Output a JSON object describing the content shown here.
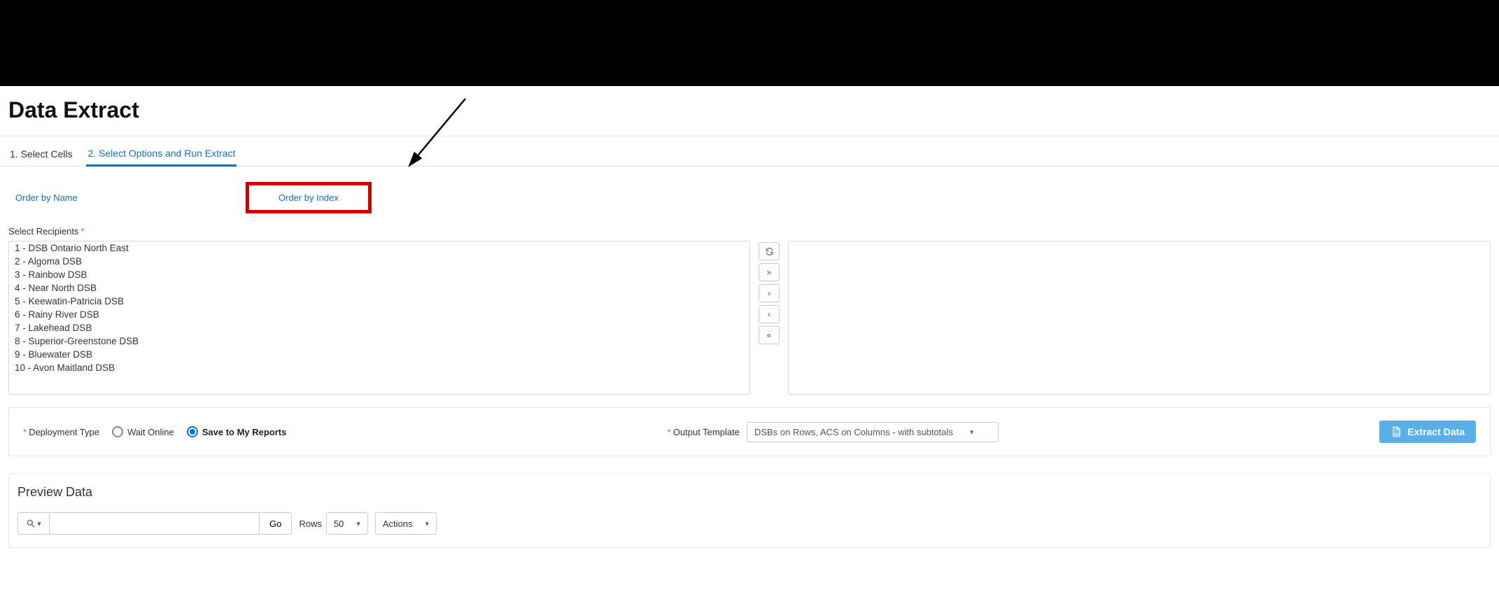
{
  "page": {
    "title": "Data Extract"
  },
  "tabs": {
    "t1": "1. Select Cells",
    "t2": "2. Select Options and Run Extract"
  },
  "order": {
    "by_name": "Order by Name",
    "by_index": "Order by Index"
  },
  "recipients": {
    "label": "Select Recipients",
    "items": [
      "1 - DSB Ontario North East",
      "2 - Algoma DSB",
      "3 - Rainbow DSB",
      "4 - Near North DSB",
      "5 - Keewatin-Patricia DSB",
      "6 - Rainy River DSB",
      "7 - Lakehead DSB",
      "8 - Superior-Greenstone DSB",
      "9 - Bluewater DSB",
      "10 - Avon Maitland DSB"
    ]
  },
  "options": {
    "deployment_label": "Deployment Type",
    "wait_online": "Wait Online",
    "save_reports": "Save to My Reports",
    "output_template_label": "Output Template",
    "output_template_value": "DSBs on Rows, ACS on Columns - with subtotals",
    "extract_btn": "Extract Data"
  },
  "preview": {
    "title": "Preview Data",
    "go": "Go",
    "rows_label": "Rows",
    "rows_value": "50",
    "actions": "Actions"
  }
}
